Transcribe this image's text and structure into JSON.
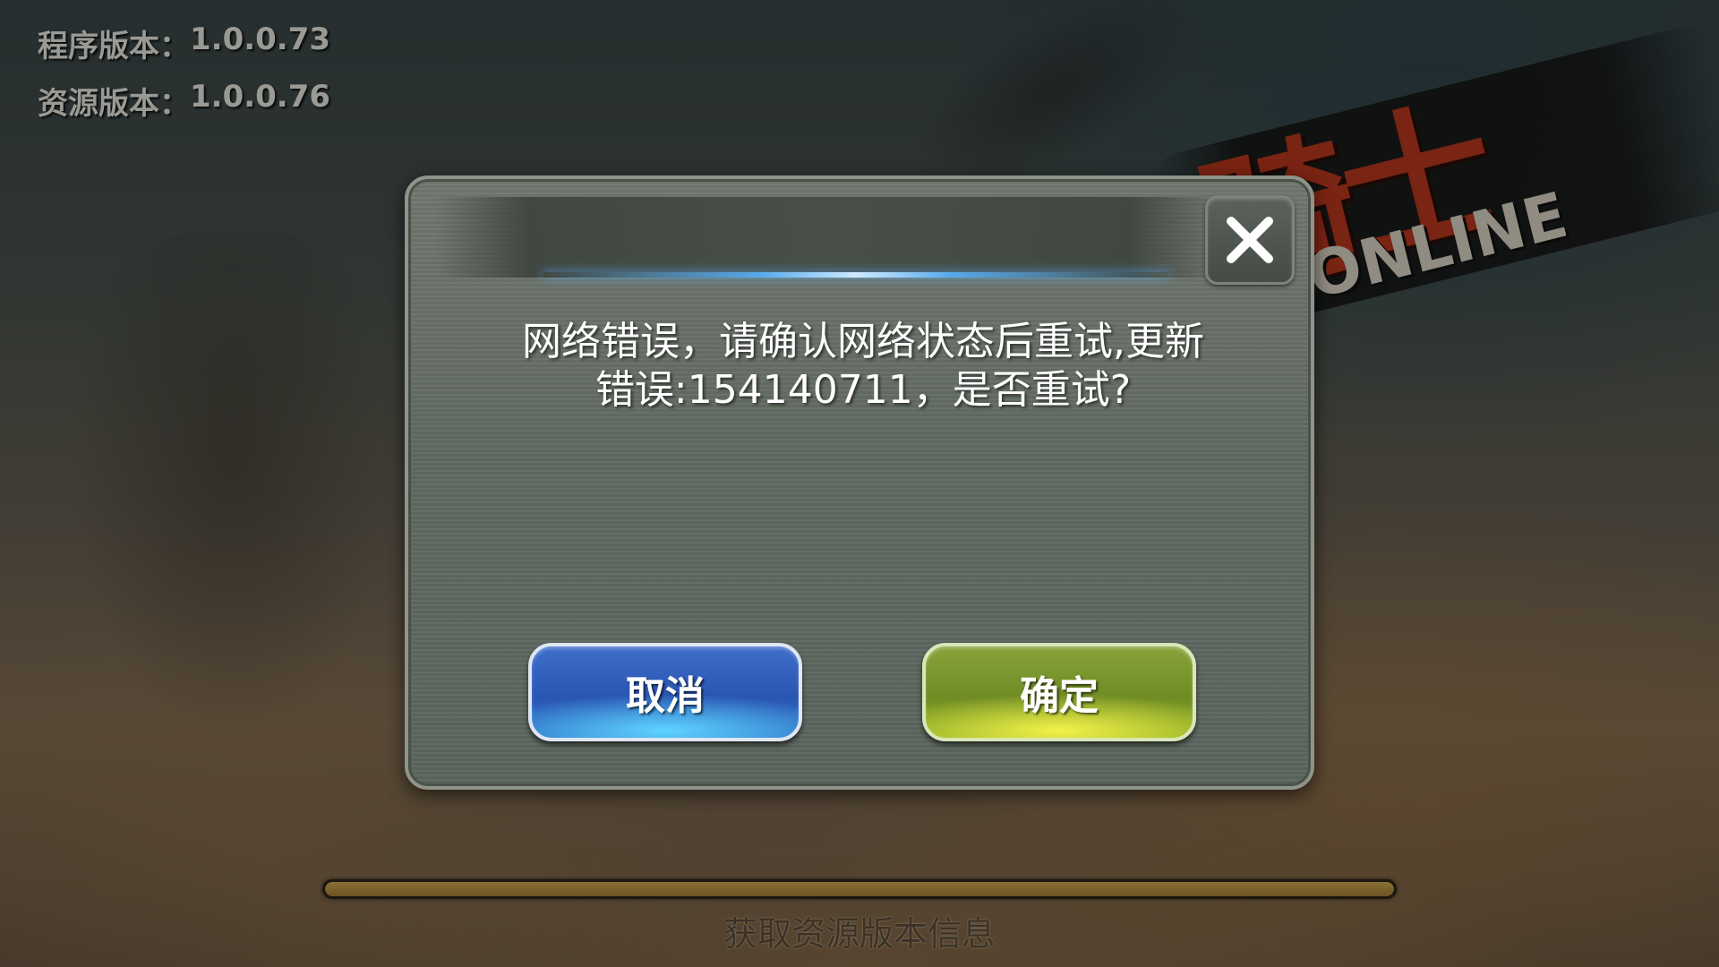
{
  "version_info": {
    "program_label": "程序版本：",
    "program_value": "1.0.0.73",
    "resource_label": "资源版本：",
    "resource_value": "1.0.0.76"
  },
  "logo": {
    "title_fragment": "骑士",
    "subtitle": "ONLINE"
  },
  "dialog": {
    "message_line1": "网络错误，请确认网络状态后重试,更新",
    "message_line2": "错误:154140711，是否重试?",
    "cancel_label": "取消",
    "ok_label": "确定",
    "close_icon": "close-icon"
  },
  "loading": {
    "status_text": "获取资源版本信息",
    "progress": 1.0
  },
  "colors": {
    "cancel_button": "#2a55b3",
    "ok_button": "#6f8c25",
    "header_glow": "#5ab4ff"
  }
}
